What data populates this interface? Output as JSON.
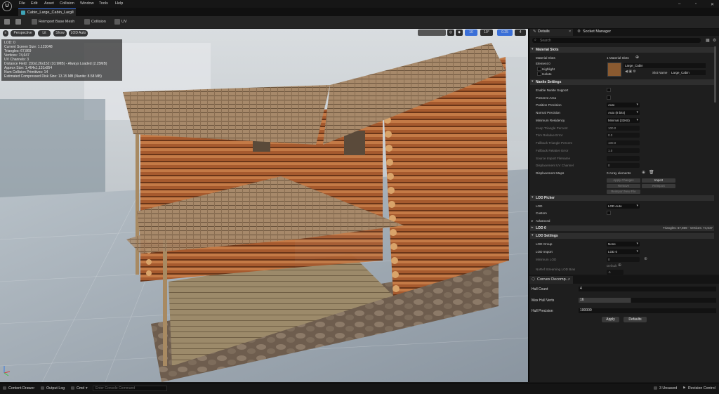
{
  "app": {
    "logo": "U"
  },
  "menu": [
    "File",
    "Edit",
    "Asset",
    "Collision",
    "Window",
    "Tools",
    "Help"
  ],
  "window_controls": [
    "–",
    "▫",
    "✕"
  ],
  "tab": {
    "label": "Cabin_Large_Cabin_Large",
    "close": "×"
  },
  "toolbar": {
    "reimport": "Reimport Base Mesh",
    "collision": "Collision",
    "uv": "UV"
  },
  "viewport": {
    "perspective": "Perspective",
    "lit": "Lit",
    "show": "Show",
    "lod_auto": "LOD Auto",
    "right": [
      "10",
      "10°",
      "0.25",
      "4"
    ],
    "stats": [
      "LOD: 0",
      "Current Screen Size: 1.123048",
      "Triangles: 67,869",
      "Vertices: 74,647",
      "UV Channels: 3",
      "Distance Field: 150x126x152 (10.9MB) - Always Loaded (2.25MB)",
      "Approx Size: 1,464x1,131x954",
      "Num Collision Primitives: 14",
      "Estimated Compressed Disk Size: 13.15 MB (Nanite: 8.58 MB)"
    ]
  },
  "details": {
    "tab_details": "Details",
    "tab_socket": "Socket Manager",
    "search_placeholder": "Search",
    "material_slots_header": "Material Slots",
    "material_slots_label": "Material Slots",
    "material_slots_value": "1 Material Slots",
    "element0": "Element 0",
    "highlight": "Highlight",
    "isolate": "Isolate",
    "material_name": "Large_Cabin",
    "slot_name_label": "Slot Name",
    "slot_name_value": "Large_Cabin",
    "nanite_header": "Nanite Settings",
    "nanite_rows": {
      "enable": "Enable Nanite Support",
      "preserve": "Preserve Area",
      "position_precision": "Position Precision",
      "position_precision_value": "Auto",
      "normal_precision": "Normal Precision",
      "normal_precision_value": "Auto (8 bits)",
      "min_residency": "Minimum Residency",
      "min_residency_value": "Minimal (32KB)",
      "keep_tri": "Keep Triangle Percent",
      "keep_tri_value": "100.0",
      "trim_error": "Trim Relative Error",
      "trim_error_value": "0.0",
      "fallback_tri": "Fallback Triangle Percent",
      "fallback_tri_value": "100.0",
      "fallback_error": "Fallback Relative Error",
      "fallback_error_value": "1.0",
      "source_import": "Source Import Filename",
      "disp_uv": "Displacement UV Channel",
      "disp_uv_value": "0",
      "disp_maps": "Displacement Maps",
      "disp_maps_value": "0 Array elements",
      "apply_changes": "Apply Changes",
      "import": "Import",
      "remove": "Remove",
      "reimport": "Reimport",
      "reimport_new": "Reimport New File"
    },
    "lod_picker_header": "LOD Picker",
    "lod_label": "LOD",
    "lod_value": "LOD Auto",
    "custom": "Custom",
    "advanced": "Advanced",
    "lod0_header": "LOD 0",
    "lod0_info": "Triangles: 67,869 · Vertices: 74,647",
    "lod_settings_header": "LOD Settings",
    "lod_group": "LOD Group",
    "lod_group_value": "None",
    "lod_import": "LOD Import",
    "lod_import_value": "LOD 0",
    "min_lod": "Minimum LOD",
    "min_lod_value": "0",
    "no_ref_streaming": "NoRef Streaming LOD Bias",
    "no_ref_value": "Default",
    "no_ref_num": "-1"
  },
  "convex": {
    "tab": "Convex Decomp...",
    "hull_count": "Hull Count",
    "hull_count_value": "4",
    "max_hull_verts": "Max Hull Verts",
    "max_hull_verts_value": "16",
    "hull_precision": "Hull Precision",
    "hull_precision_value": "100000",
    "apply": "Apply",
    "defaults": "Defaults"
  },
  "statusbar": {
    "content_drawer": "Content Drawer",
    "output_log": "Output Log",
    "cmd": "Cmd",
    "console_placeholder": "Enter Console Command",
    "unsaved": "3 Unsaved",
    "revision": "Revision Control"
  }
}
